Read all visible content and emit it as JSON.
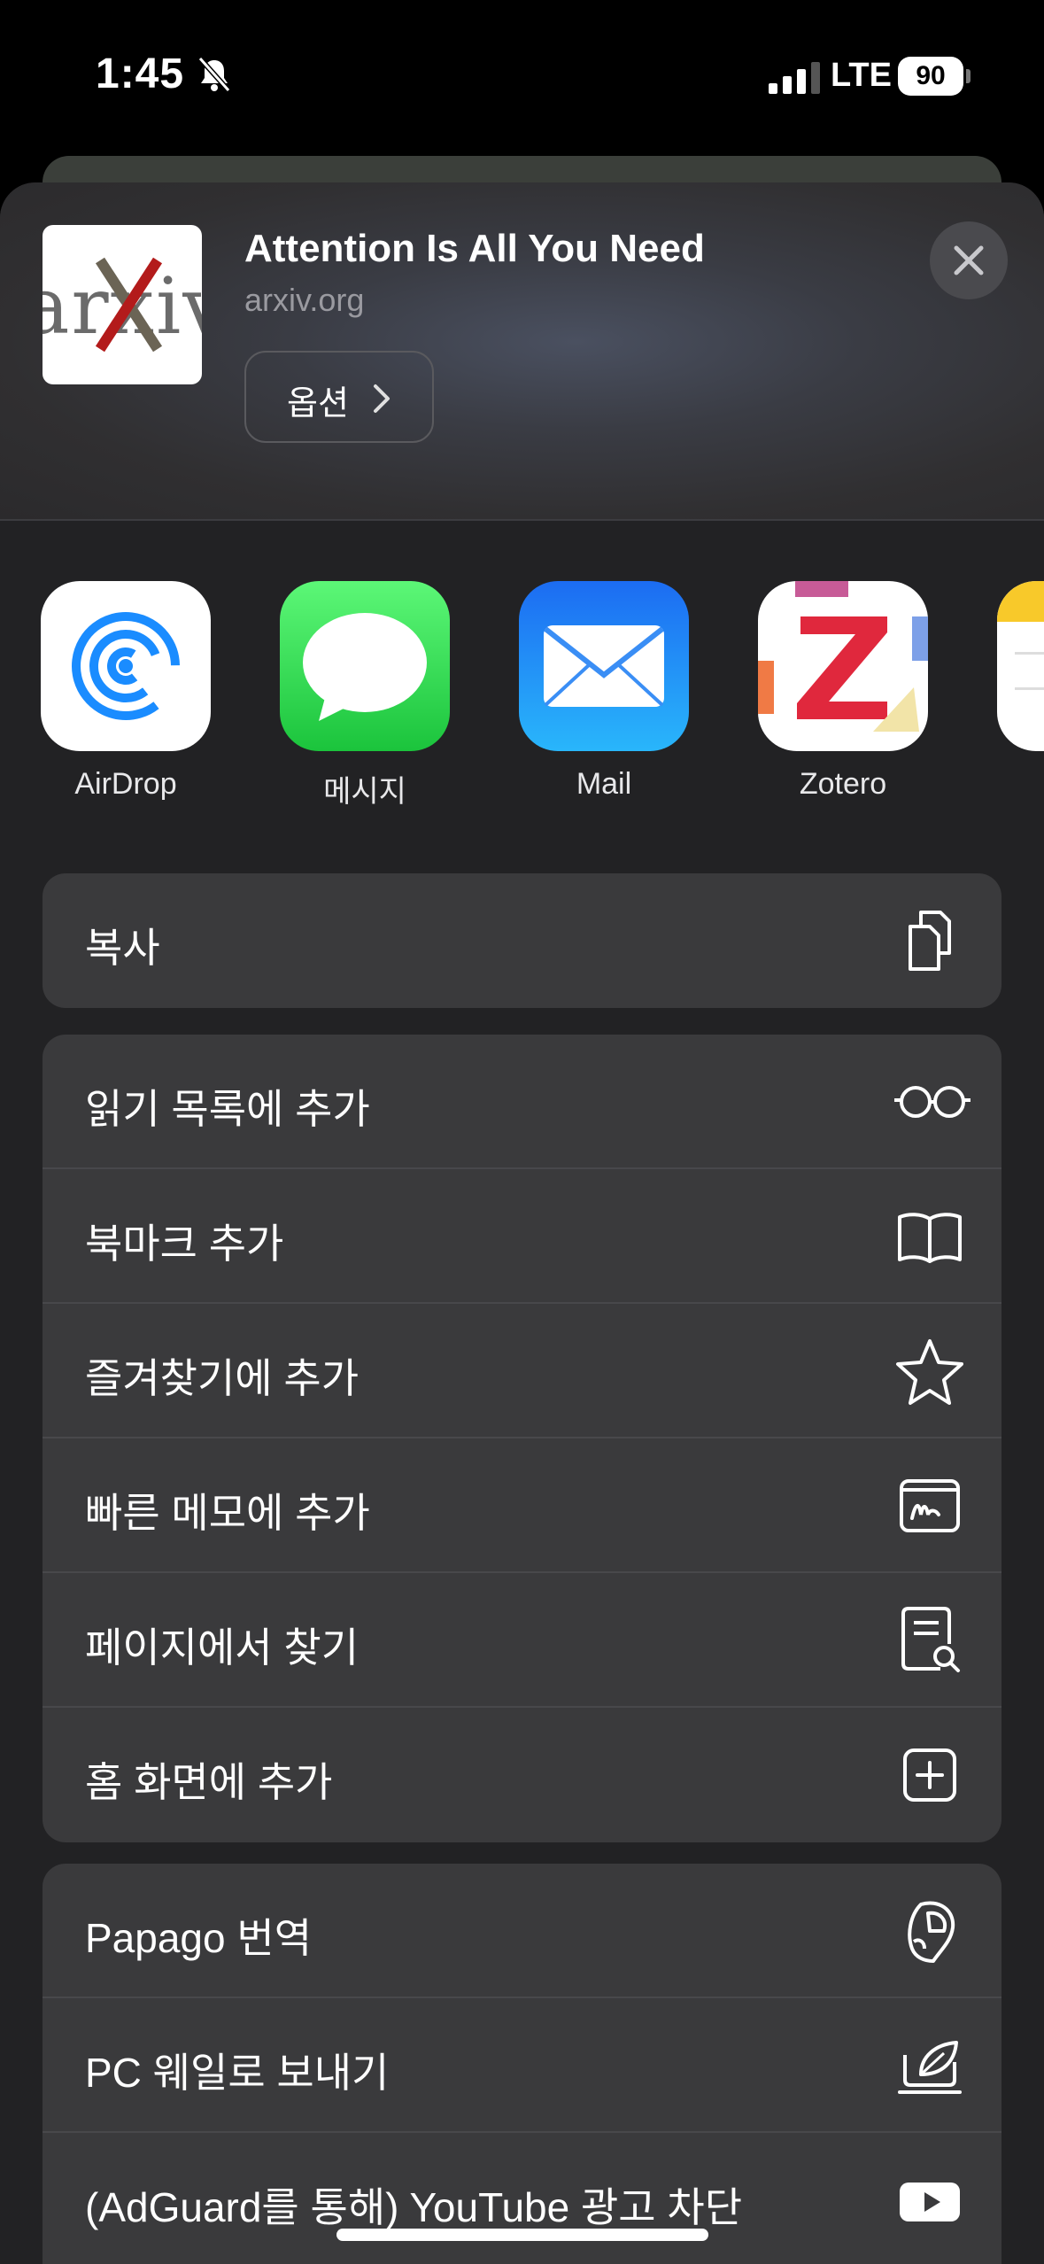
{
  "status_bar": {
    "time": "1:45",
    "network": "LTE",
    "battery": "90",
    "icons": [
      "bell-slash-icon",
      "signal-icon",
      "battery-icon"
    ]
  },
  "header": {
    "title": "Attention Is All You Need",
    "url": "arxiv.org",
    "options_label": "옵션",
    "thumbnail_text": "arxiv"
  },
  "apps": [
    {
      "label": "AirDrop",
      "icon": "airdrop-icon"
    },
    {
      "label": "메시지",
      "icon": "messages-icon"
    },
    {
      "label": "Mail",
      "icon": "mail-icon"
    },
    {
      "label": "Zotero",
      "icon": "zotero-icon"
    }
  ],
  "actions": {
    "group1": [
      {
        "label": "복사",
        "icon": "copy-icon"
      }
    ],
    "group2": [
      {
        "label": "읽기 목록에 추가",
        "icon": "glasses-icon"
      },
      {
        "label": "북마크 추가",
        "icon": "book-icon"
      },
      {
        "label": "즐겨찾기에 추가",
        "icon": "star-icon"
      },
      {
        "label": "빠른 메모에 추가",
        "icon": "quick-note-icon"
      },
      {
        "label": "페이지에서 찾기",
        "icon": "find-in-page-icon"
      },
      {
        "label": "홈 화면에 추가",
        "icon": "add-square-icon"
      }
    ],
    "group3": [
      {
        "label": "Papago 번역",
        "icon": "papago-icon"
      },
      {
        "label": "PC 웨일로 보내기",
        "icon": "whale-icon"
      },
      {
        "label": "(AdGuard를 통해) YouTube 광고 차단",
        "icon": "youtube-icon"
      }
    ]
  }
}
